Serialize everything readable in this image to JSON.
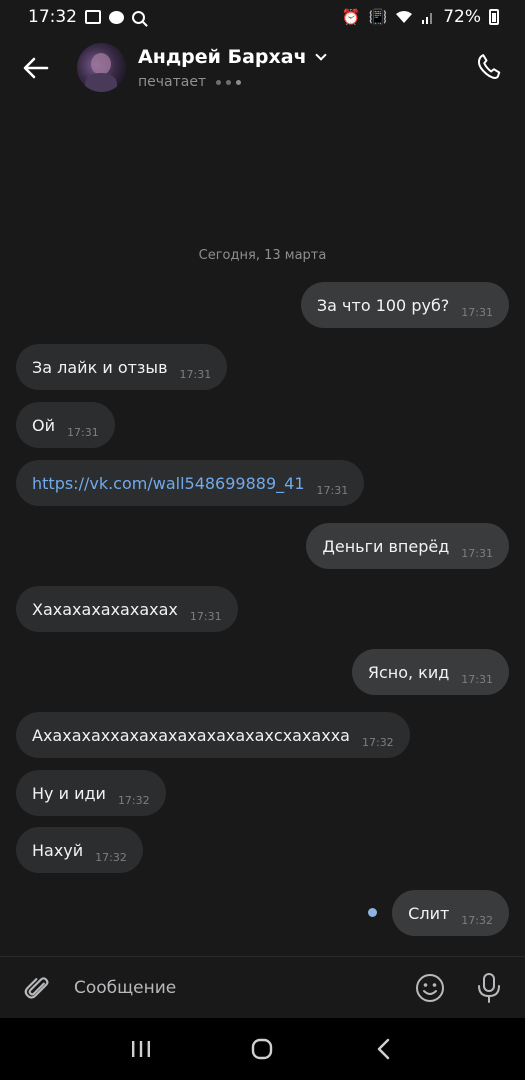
{
  "status_bar": {
    "time": "17:32",
    "battery": "72%",
    "left_icons": [
      "image-icon",
      "message-icon",
      "search-icon"
    ],
    "right_icons": [
      "alarm-icon",
      "vibrate-icon",
      "wifi-icon",
      "signal-icon",
      "battery-icon"
    ]
  },
  "header": {
    "contact_name": "Андрей Бархач",
    "status": "печатает"
  },
  "chat": {
    "date": "Сегодня, 13 марта",
    "messages": [
      {
        "dir": "out",
        "text": "За что 100 руб?",
        "time": "17:31"
      },
      {
        "dir": "in",
        "text": "За лайк и отзыв",
        "time": "17:31"
      },
      {
        "dir": "in",
        "text": "Ой",
        "time": "17:31"
      },
      {
        "dir": "in",
        "text": "https://vk.com/wall548699889_41",
        "time": "17:31"
      },
      {
        "dir": "out",
        "text": "Деньги вперёд",
        "time": "17:31"
      },
      {
        "dir": "in",
        "text": "Хахахахахахахах",
        "time": "17:31"
      },
      {
        "dir": "out",
        "text": "Ясно, кид",
        "time": "17:31"
      },
      {
        "dir": "in",
        "text": "Ахахахаххахахахахахахахахсхахахха",
        "time": "17:32"
      },
      {
        "dir": "in",
        "text": "Ну и иди",
        "time": "17:32"
      },
      {
        "dir": "in",
        "text": "Нахуй",
        "time": "17:32"
      },
      {
        "dir": "out",
        "text": "Слит",
        "time": "17:32"
      }
    ]
  },
  "composer": {
    "placeholder": "Сообщение"
  },
  "colors": {
    "background": "#19191a",
    "bubble_in": "#2c2d2e",
    "bubble_out": "#3a3b3c",
    "link": "#71aaeb",
    "unread_dot": "#8fb3e0"
  }
}
